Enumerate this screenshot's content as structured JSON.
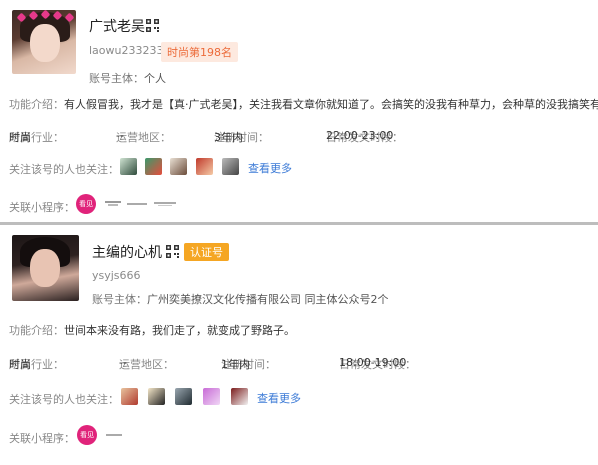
{
  "cards": [
    {
      "name": "广式老吴",
      "account_id": "laowu233233",
      "rank_badge": "时尚第198名",
      "subject_label": "账号主体：",
      "subject_value": "个人",
      "intro_label": "功能介绍：",
      "intro": "有人假冒我，我才是【真·广式老吴】，关注我看文章你就知道了。会搞笑的没我有种草力，会种草的没我搞笑有趣！",
      "industry_label": "所属行业：",
      "industry": "时尚",
      "region_label": "运营地区：",
      "region": "--",
      "reg_label": "注册时间：",
      "reg_time": "3年内",
      "post_label": "日常发文时段：",
      "post_time": "22:00-23:00",
      "also_follow_label": "关注该号的人也关注：",
      "see_more": "查看更多",
      "mini_label": "关联小程序：",
      "mini_red_text": "看见你"
    },
    {
      "name": "主编的心机",
      "account_id": "ysyjs666",
      "cert_badge": "认证号",
      "subject_label": "账号主体：",
      "subject_value": "广州奕美撩汉文化传播有限公司 同主体公众号2个",
      "intro_label": "功能介绍：",
      "intro": "世间本来没有路，我们走了，就变成了野路子。",
      "industry_label": "所属行业：",
      "industry": "时尚",
      "region_label": "运营地区：",
      "region": "--",
      "reg_label": "注册时间：",
      "reg_time": "1年内",
      "post_label": "日常发文时段：",
      "post_time": "18:00-19:00",
      "also_follow_label": "关注该号的人也关注：",
      "see_more": "查看更多",
      "mini_label": "关联小程序：",
      "mini_red_text": "看见你"
    }
  ],
  "colors": {
    "rank_badge_bg": "#fde9df",
    "rank_badge_text": "#ec6b3a",
    "cert_badge_bg": "#f5a623",
    "link": "#3b7ad6",
    "divider": "#bdbdbd"
  },
  "icons": [
    "qr-code-icon",
    "mini-program-logo"
  ]
}
